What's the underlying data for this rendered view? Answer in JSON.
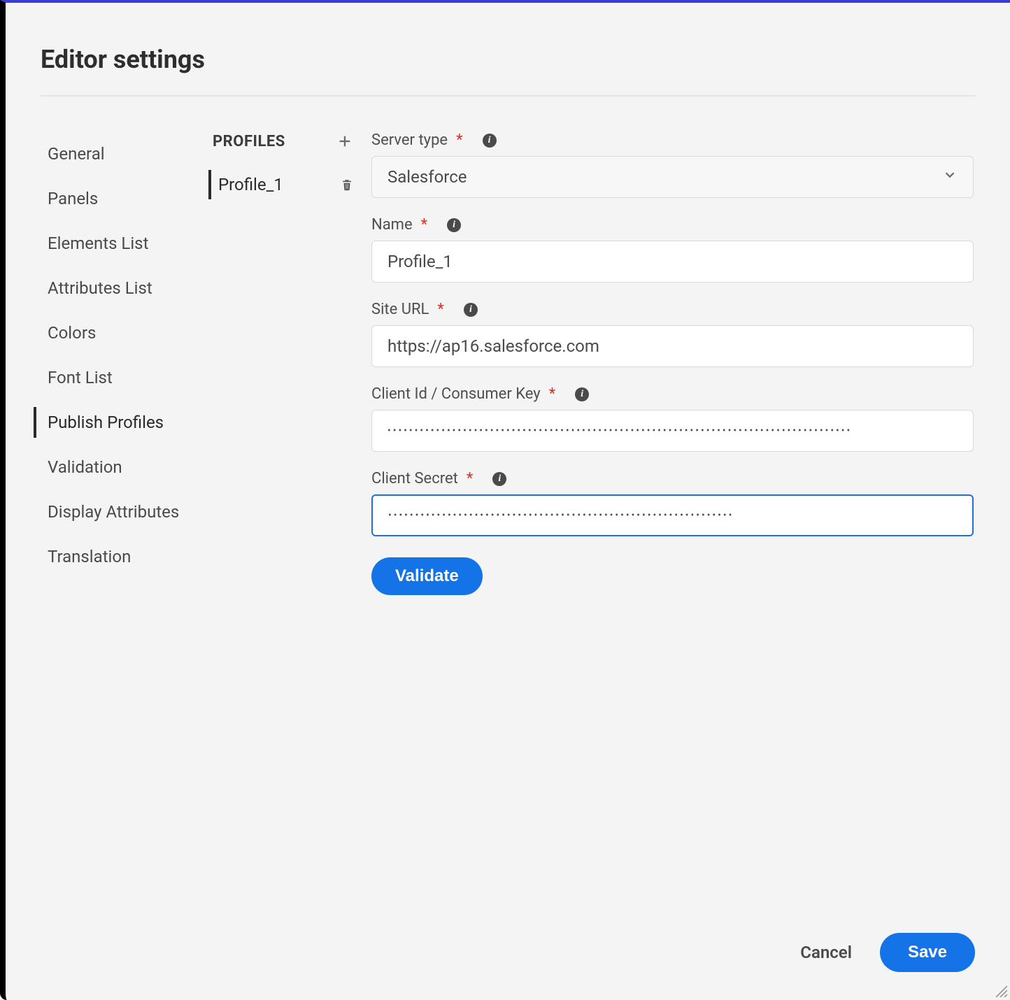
{
  "header": {
    "title": "Editor settings"
  },
  "nav": {
    "items": [
      {
        "label": "General"
      },
      {
        "label": "Panels"
      },
      {
        "label": "Elements List"
      },
      {
        "label": "Attributes List"
      },
      {
        "label": "Colors"
      },
      {
        "label": "Font List"
      },
      {
        "label": "Publish Profiles"
      },
      {
        "label": "Validation"
      },
      {
        "label": "Display Attributes"
      },
      {
        "label": "Translation"
      }
    ],
    "active_index": 6
  },
  "profiles": {
    "header": "PROFILES",
    "items": [
      {
        "label": "Profile_1"
      }
    ],
    "active_index": 0
  },
  "form": {
    "server_type": {
      "label": "Server type",
      "value": "Salesforce"
    },
    "name": {
      "label": "Name",
      "value": "Profile_1"
    },
    "site_url": {
      "label": "Site URL",
      "value": "https://ap16.salesforce.com"
    },
    "client_id": {
      "label": "Client Id / Consumer Key",
      "value": "••••••••••••••••••••••••••••••••••••••••••••••••••••••••••••••••••••••••••••••••••••••"
    },
    "client_secret": {
      "label": "Client Secret",
      "value": "••••••••••••••••••••••••••••••••••••••••••••••••••••••••••••••••"
    },
    "validate_label": "Validate"
  },
  "footer": {
    "cancel": "Cancel",
    "save": "Save"
  }
}
